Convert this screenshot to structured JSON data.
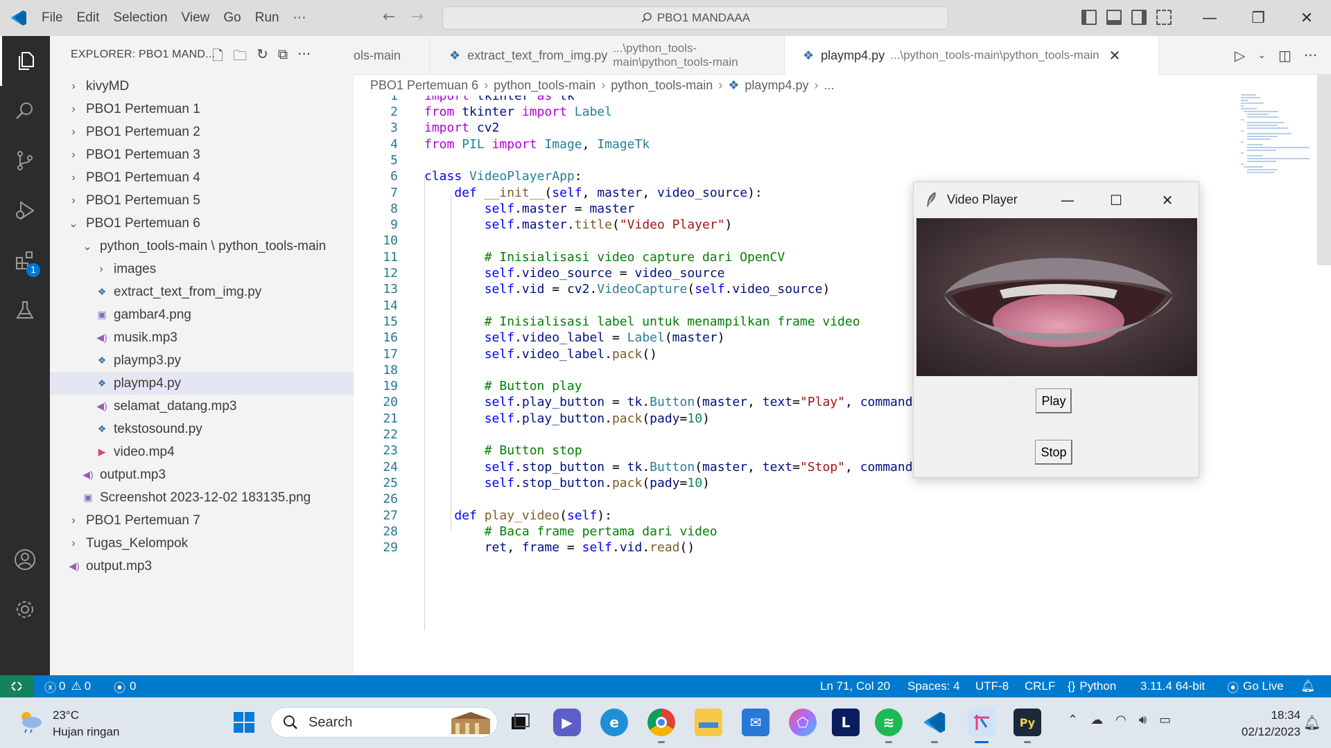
{
  "titlebar": {
    "menu": [
      "File",
      "Edit",
      "Selection",
      "View",
      "Go",
      "Run",
      "···"
    ],
    "search": "PBO1 MANDAAA"
  },
  "activitybar": {
    "badge": "1"
  },
  "explorer": {
    "title": "EXPLORER: PBO1 MAND...",
    "items": [
      {
        "label": "kivyMD",
        "depth": 0,
        "type": "folder",
        "chev": "›"
      },
      {
        "label": "PBO1 Pertemuan 1",
        "depth": 0,
        "type": "folder",
        "chev": "›"
      },
      {
        "label": "PBO1 Pertemuan 2",
        "depth": 0,
        "type": "folder",
        "chev": "›"
      },
      {
        "label": "PBO1 Pertemuan 3",
        "depth": 0,
        "type": "folder",
        "chev": "›"
      },
      {
        "label": "PBO1 Pertemuan 4",
        "depth": 0,
        "type": "folder",
        "chev": "›"
      },
      {
        "label": "PBO1 Pertemuan 5",
        "depth": 0,
        "type": "folder",
        "chev": "›"
      },
      {
        "label": "PBO1 Pertemuan 6",
        "depth": 0,
        "type": "folder-open",
        "chev": "⌄"
      },
      {
        "label": "python_tools-main \\ python_tools-main",
        "depth": 1,
        "type": "folder-open",
        "chev": "⌄"
      },
      {
        "label": "images",
        "depth": 2,
        "type": "folder",
        "chev": "›"
      },
      {
        "label": "extract_text_from_img.py",
        "depth": 2,
        "type": "python"
      },
      {
        "label": "gambar4.png",
        "depth": 2,
        "type": "image"
      },
      {
        "label": "musik.mp3",
        "depth": 2,
        "type": "audio"
      },
      {
        "label": "playmp3.py",
        "depth": 2,
        "type": "python"
      },
      {
        "label": "playmp4.py",
        "depth": 2,
        "type": "python",
        "selected": true
      },
      {
        "label": "selamat_datang.mp3",
        "depth": 2,
        "type": "audio"
      },
      {
        "label": "tekstosound.py",
        "depth": 2,
        "type": "python"
      },
      {
        "label": "video.mp4",
        "depth": 2,
        "type": "video"
      },
      {
        "label": "output.mp3",
        "depth": 1,
        "type": "audio"
      },
      {
        "label": "Screenshot 2023-12-02 183135.png",
        "depth": 1,
        "type": "image"
      },
      {
        "label": "PBO1 Pertemuan 7",
        "depth": 0,
        "type": "folder",
        "chev": "›"
      },
      {
        "label": "Tugas_Kelompok",
        "depth": 0,
        "type": "folder",
        "chev": "›"
      },
      {
        "label": "output.mp3",
        "depth": 0,
        "type": "audio"
      }
    ]
  },
  "tabs": [
    {
      "label": "ols-main",
      "path": ""
    },
    {
      "label": "extract_text_from_img.py",
      "path": "...\\python_tools-main\\python_tools-main"
    },
    {
      "label": "playmp4.py",
      "path": "...\\python_tools-main\\python_tools-main"
    }
  ],
  "breadcrumb": [
    "PBO1 Pertemuan 6",
    "python_tools-main",
    "python_tools-main",
    "playmp4.py",
    "..."
  ],
  "code_lines": [
    "import tkinter as tk",
    "from tkinter import Label",
    "import cv2",
    "from PIL import Image, ImageTk",
    "",
    "class VideoPlayerApp:",
    "    def __init__(self, master, video_source):",
    "        self.master = master",
    "        self.master.title(\"Video Player\")",
    "",
    "        # Inisialisasi video capture dari OpenCV",
    "        self.video_source = video_source",
    "        self.vid = cv2.VideoCapture(self.video_source)",
    "",
    "        # Inisialisasi label untuk menampilkan frame video",
    "        self.video_label = Label(master)",
    "        self.video_label.pack()",
    "",
    "        # Button play",
    "        self.play_button = tk.Button(master, text=\"Play\", command=self.play_video)",
    "        self.play_button.pack(pady=10)",
    "",
    "        # Button stop",
    "        self.stop_button = tk.Button(master, text=\"Stop\", command=self.stop_video)",
    "        self.stop_button.pack(pady=10)",
    "",
    "    def play_video(self):",
    "        # Baca frame pertama dari video",
    "        ret, frame = self.vid.read()"
  ],
  "video_player": {
    "title": "Video Player",
    "play_label": "Play",
    "stop_label": "Stop"
  },
  "statusbar": {
    "errors": "0",
    "warnings": "0",
    "ports": "0",
    "position": "Ln 71, Col 20",
    "spaces": "Spaces: 4",
    "encoding": "UTF-8",
    "eol": "CRLF",
    "language": "Python",
    "interpreter": "3.11.4 64-bit",
    "golive": "Go Live"
  },
  "taskbar": {
    "temperature": "23°C",
    "weather": "Hujan ringan",
    "search_placeholder": "Search",
    "time": "18:34",
    "date": "02/12/2023"
  },
  "colors": {
    "statusbar": "#007acc",
    "activitybar": "#2c2c2c",
    "sidebar": "#f3f3f3",
    "accent": "#0078d4"
  }
}
